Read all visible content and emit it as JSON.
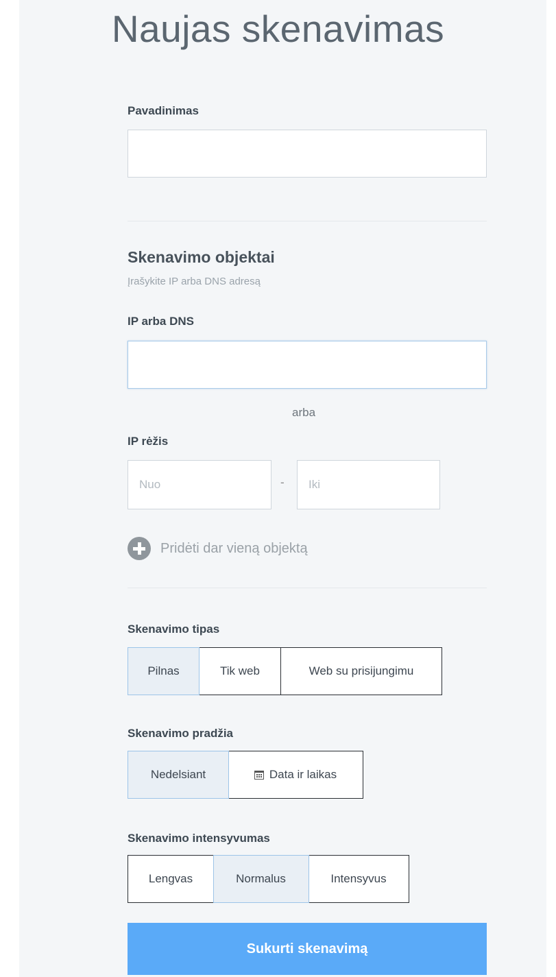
{
  "page": {
    "title": "Naujas skenavimas"
  },
  "name_field": {
    "label": "Pavadinimas",
    "value": "",
    "placeholder": ""
  },
  "targets": {
    "title": "Skenavimo objektai",
    "hint": "Įrašykite IP arba DNS adresą",
    "ip_dns": {
      "label": "IP arba DNS",
      "value": "",
      "placeholder": ""
    },
    "or_text": "arba",
    "ip_range": {
      "label": "IP rėžis",
      "from_placeholder": "Nuo",
      "separator": "-",
      "to_placeholder": "Iki"
    },
    "add_more": {
      "label": "Pridėti dar vieną objektą",
      "icon": "plus-circle-icon"
    }
  },
  "scan_type": {
    "label": "Skenavimo tipas",
    "options": [
      "Pilnas",
      "Tik web",
      "Web su prisijungimu"
    ],
    "selected": "Pilnas"
  },
  "scan_start": {
    "label": "Skenavimo pradžia",
    "options": [
      "Nedelsiant",
      "Data ir laikas"
    ],
    "selected": "Nedelsiant",
    "date_icon": "calendar-icon"
  },
  "scan_intensity": {
    "label": "Skenavimo intensyvumas",
    "options": [
      "Lengvas",
      "Normalus",
      "Intensyvus"
    ],
    "selected": "Normalus"
  },
  "submit": {
    "label": "Sukurti skenavimą",
    "color": "#5aaaf8"
  }
}
